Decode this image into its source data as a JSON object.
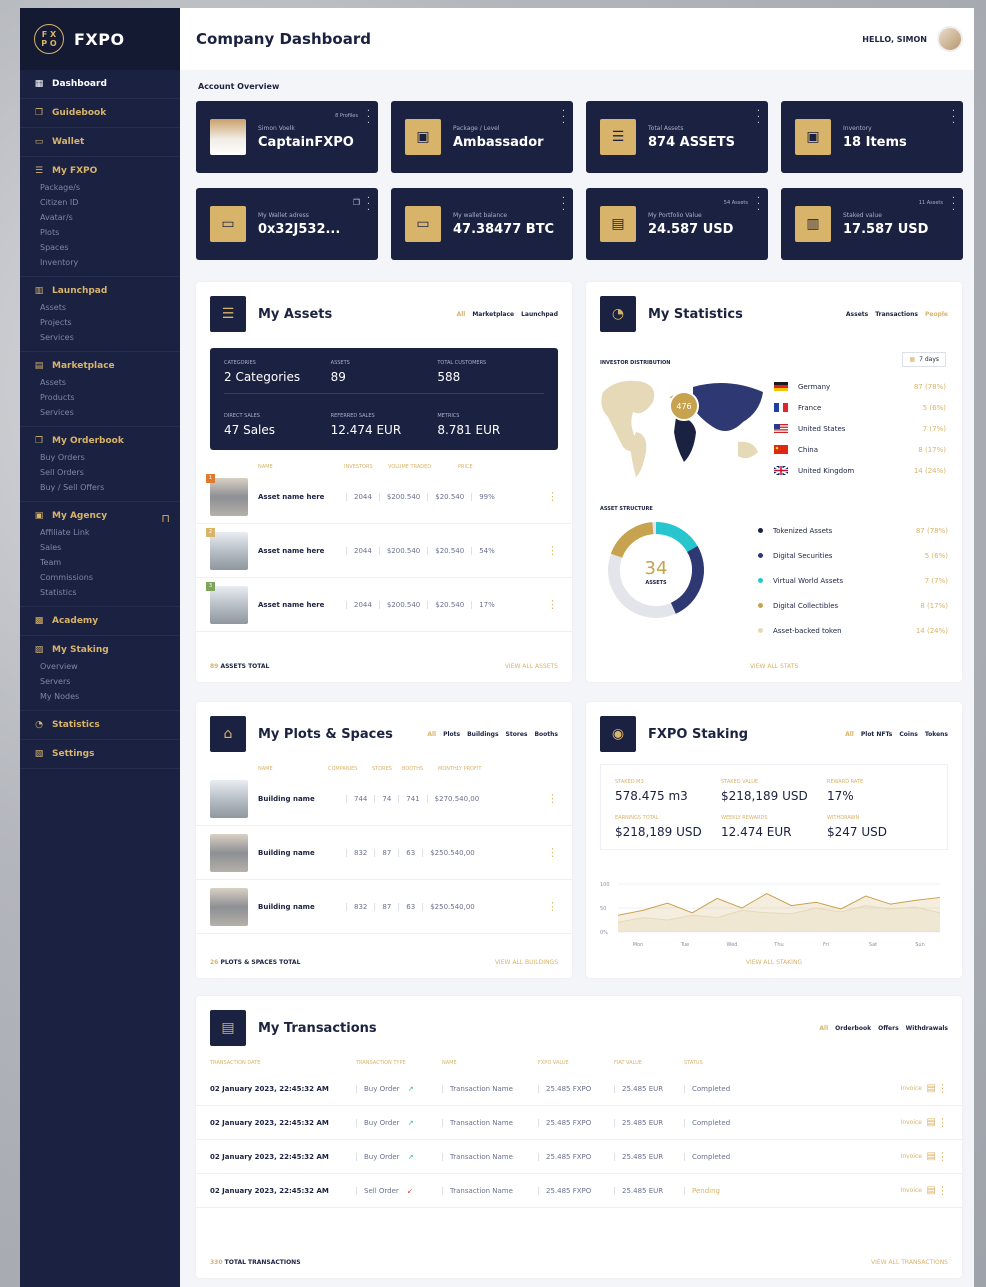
{
  "brand": {
    "name": "FXPO",
    "badge": "F X\nP O"
  },
  "sidebar": {
    "items": [
      {
        "label": "Dashboard",
        "icon": "grid-icon"
      },
      {
        "label": "Guidebook",
        "icon": "book-icon"
      },
      {
        "label": "Wallet",
        "icon": "wallet-icon"
      },
      {
        "label": "My FXPO",
        "icon": "list-icon",
        "subs": [
          "Package/s",
          "Citizen ID",
          "Avatar/s",
          "Plots",
          "Spaces",
          "Inventory"
        ]
      },
      {
        "label": "Launchpad",
        "icon": "launch-icon",
        "subs": [
          "Assets",
          "Projects",
          "Services"
        ]
      },
      {
        "label": "Marketplace",
        "icon": "store-icon",
        "subs": [
          "Assets",
          "Products",
          "Services"
        ]
      },
      {
        "label": "My Orderbook",
        "icon": "book-icon",
        "subs": [
          "Buy Orders",
          "Sell Orders",
          "Buy / Sell Offers"
        ]
      },
      {
        "label": "My Agency",
        "icon": "agency-icon",
        "subs": [
          "Affiliate Link",
          "Sales",
          "Team",
          "Commissions",
          "Statistics"
        ]
      },
      {
        "label": "Academy",
        "icon": "academy-icon"
      },
      {
        "label": "My Staking",
        "icon": "staking-icon",
        "subs": [
          "Overview",
          "Servers",
          "My Nodes"
        ]
      },
      {
        "label": "Statistics",
        "icon": "chart-icon"
      },
      {
        "label": "Settings",
        "icon": "settings-icon"
      }
    ]
  },
  "header": {
    "title": "Company Dashboard",
    "greeting": "HELLO, SIMON"
  },
  "overview": {
    "label": "Account Overview",
    "cards": [
      {
        "sub": "Simon Voelk",
        "value": "CaptainFXPO",
        "tag": "8 Profiles"
      },
      {
        "sub": "Package / Level",
        "value": "Ambassador",
        "tag": ""
      },
      {
        "sub": "Total Assets",
        "value": "874 ASSETS",
        "tag": ""
      },
      {
        "sub": "Inventory",
        "value": "18 Items",
        "tag": ""
      },
      {
        "sub": "My Wallet adress",
        "value": "0x32J532...",
        "tag": ""
      },
      {
        "sub": "My wallet balance",
        "value": "47.38477 BTC",
        "tag": ""
      },
      {
        "sub": "My Portfolio Value",
        "value": "24.587 USD",
        "tag": "54 Assets"
      },
      {
        "sub": "Staked value",
        "value": "17.587 USD",
        "tag": "11 Assets"
      }
    ]
  },
  "assets": {
    "title": "My Assets",
    "filters": [
      "All",
      "Marketplace",
      "Launchpad"
    ],
    "stats": [
      {
        "label": "CATEGORIES",
        "value": "2 Categories"
      },
      {
        "label": "ASSETS",
        "value": "89"
      },
      {
        "label": "TOTAL CUSTOMERS",
        "value": "588"
      },
      {
        "label": "DIRECT SALES",
        "value": "47 Sales"
      },
      {
        "label": "REFERRED SALES",
        "value": "12.474 EUR"
      },
      {
        "label": "METRICS",
        "value": "8.781 EUR"
      }
    ],
    "columns": [
      "NAME",
      "INVESTORS",
      "VOLUME TRADED",
      "PRICE"
    ],
    "rows": [
      {
        "badge": "1",
        "name": "Asset name here",
        "investors": "2044",
        "volume": "$200.540",
        "price": "$20.540",
        "pct": "99%"
      },
      {
        "badge": "2",
        "name": "Asset name here",
        "investors": "2044",
        "volume": "$200.540",
        "price": "$20.540",
        "pct": "54%"
      },
      {
        "badge": "3",
        "name": "Asset name here",
        "investors": "2044",
        "volume": "$200.540",
        "price": "$20.540",
        "pct": "17%"
      }
    ],
    "footer_count": "89",
    "footer_label": "ASSETS TOTAL",
    "footer_link": "VIEW ALL ASSETS"
  },
  "statistics": {
    "title": "My Statistics",
    "filters": [
      "Assets",
      "Transactions",
      "People"
    ],
    "investor_label": "INVESTOR DISTRIBUTION",
    "period": "7 days",
    "map_badge": "476",
    "countries": [
      {
        "name": "Germany",
        "value": "87 (78%)"
      },
      {
        "name": "France",
        "value": "5 (6%)"
      },
      {
        "name": "United States",
        "value": "7 (7%)"
      },
      {
        "name": "China",
        "value": "8 (17%)"
      },
      {
        "name": "United Kingdom",
        "value": "14 (24%)"
      }
    ],
    "structure_label": "ASSET STRUCTURE",
    "donut_value": "34",
    "donut_label": "ASSETS",
    "structure": [
      {
        "name": "Tokenized Assets",
        "value": "87 (78%)",
        "color": "#1b2140"
      },
      {
        "name": "Digital Securities",
        "value": "5 (6%)",
        "color": "#2e3872"
      },
      {
        "name": "Virtual World Assets",
        "value": "7 (7%)",
        "color": "#27c6cf"
      },
      {
        "name": "Digital Collectibles",
        "value": "8 (17%)",
        "color": "#c7a24f"
      },
      {
        "name": "Asset-backed token",
        "value": "14 (24%)",
        "color": "#e6d9b8"
      }
    ],
    "footer_link": "VIEW ALL STATS"
  },
  "plots": {
    "title": "My Plots & Spaces",
    "filters": [
      "All",
      "Plots",
      "Buildings",
      "Stores",
      "Booths"
    ],
    "columns": [
      "NAME",
      "COMPANIES",
      "STORES",
      "BOOTHS",
      "MONTHLY PROFIT"
    ],
    "rows": [
      {
        "name": "Building name",
        "companies": "744",
        "stores": "74",
        "booths": "741",
        "profit": "$270.540,00"
      },
      {
        "name": "Building name",
        "companies": "832",
        "stores": "87",
        "booths": "63",
        "profit": "$250.540,00"
      },
      {
        "name": "Building name",
        "companies": "832",
        "stores": "87",
        "booths": "63",
        "profit": "$250.540,00"
      }
    ],
    "footer_count": "26",
    "footer_label": "PLOTS & SPACES TOTAL",
    "footer_link": "VIEW ALL BUILDINGS"
  },
  "staking": {
    "title": "FXPO Staking",
    "filters": [
      "All",
      "Plot NFTs",
      "Coins",
      "Tokens"
    ],
    "stats": [
      {
        "label": "STAKED M3",
        "value": "578.475 m3"
      },
      {
        "label": "STAKED VALUE",
        "value": "$218,189 USD"
      },
      {
        "label": "REWARD RATE",
        "value": "17%"
      },
      {
        "label": "EARNINGS TOTAL",
        "value": "$218,189 USD"
      },
      {
        "label": "WEEKLY REWARDS",
        "value": "12.474 EUR"
      },
      {
        "label": "WITHDRAWN",
        "value": "$247 USD"
      }
    ],
    "chart_data": {
      "type": "area",
      "x": [
        "Mon",
        "Tue",
        "Wed",
        "Thu",
        "Fri",
        "Sat",
        "Sun"
      ],
      "y_ticks": [
        "100",
        "50",
        "0%"
      ],
      "series": [
        {
          "values": [
            35,
            45,
            60,
            40,
            70,
            50,
            80,
            55,
            62,
            48,
            75,
            58,
            66,
            72
          ]
        },
        {
          "values": [
            20,
            30,
            25,
            35,
            30,
            45,
            40,
            38,
            50,
            42,
            55,
            48,
            52,
            40
          ]
        }
      ]
    },
    "footer_link": "VIEW ALL STAKING"
  },
  "transactions": {
    "title": "My Transactions",
    "filters": [
      "All",
      "Orderbook",
      "Offers",
      "Withdrawals"
    ],
    "columns": [
      "TRANSACTION DATE",
      "TRANSACTION TYPE",
      "NAME",
      "FXPO VALUE",
      "FIAT VALUE",
      "STATUS"
    ],
    "rows": [
      {
        "date": "02 January 2023, 22:45:32 AM",
        "type": "Buy Order",
        "name": "Transaction Name",
        "fxpo": "25.485 FXPO",
        "fiat": "25.485 EUR",
        "status": "Completed",
        "direction": "up"
      },
      {
        "date": "02 January 2023, 22:45:32 AM",
        "type": "Buy Order",
        "name": "Transaction Name",
        "fxpo": "25.485 FXPO",
        "fiat": "25.485 EUR",
        "status": "Completed",
        "direction": "up"
      },
      {
        "date": "02 January 2023, 22:45:32 AM",
        "type": "Buy Order",
        "name": "Transaction Name",
        "fxpo": "25.485 FXPO",
        "fiat": "25.485 EUR",
        "status": "Completed",
        "direction": "up"
      },
      {
        "date": "02 January 2023, 22:45:32 AM",
        "type": "Sell Order",
        "name": "Transaction Name",
        "fxpo": "25.485 FXPO",
        "fiat": "25.485 EUR",
        "status": "Pending",
        "direction": "down"
      }
    ],
    "invoice_label": "Invoice",
    "footer_count": "330",
    "footer_label": "TOTAL TRANSACTIONS",
    "footer_link": "VIEW ALL TRANSACTIONS"
  }
}
